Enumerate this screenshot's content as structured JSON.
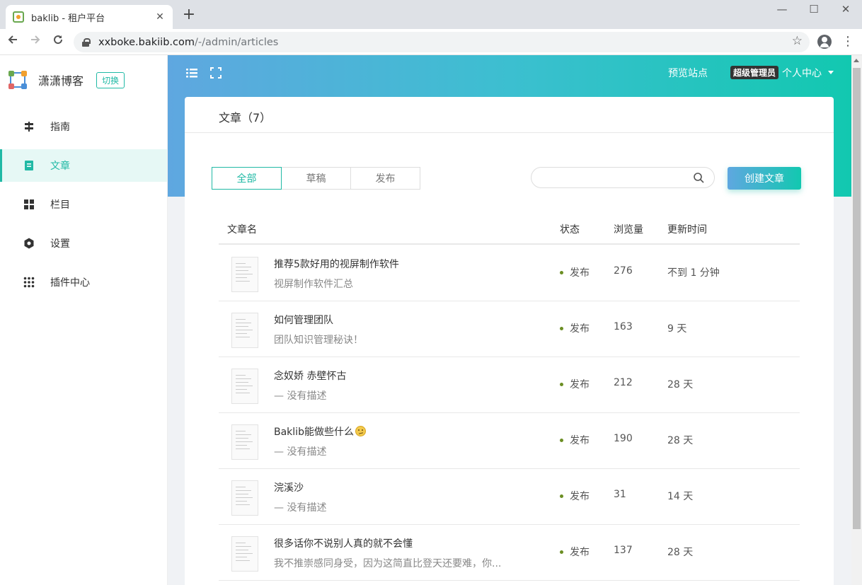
{
  "browser": {
    "tab_title": "baklib - 租户平台",
    "tab_close": "✕",
    "new_tab": "+",
    "url_host": "xxboke.bakiib.com",
    "url_path": "/-/admin/articles",
    "window_minimize": "—",
    "window_maximize": "☐",
    "window_close": "✕"
  },
  "sidebar": {
    "brand_name": "潇潇博客",
    "switch_label": "切换",
    "items": [
      {
        "label": "指南",
        "icon": "signpost-icon"
      },
      {
        "label": "文章",
        "icon": "document-icon",
        "active": true
      },
      {
        "label": "栏目",
        "icon": "grid-icon"
      },
      {
        "label": "设置",
        "icon": "gear-icon"
      },
      {
        "label": "插件中心",
        "icon": "apps-icon"
      }
    ]
  },
  "topbar": {
    "preview": "预览站点",
    "role_badge": "超级管理员",
    "user_center": "个人中心"
  },
  "page": {
    "title": "文章（7）",
    "filters": [
      "全部",
      "草稿",
      "发布"
    ],
    "active_filter": "全部",
    "search_placeholder": "",
    "create_button": "创建文章"
  },
  "table": {
    "headers": {
      "name": "文章名",
      "status": "状态",
      "views": "浏览量",
      "updated": "更新时间"
    },
    "rows": [
      {
        "title": "推荐5款好用的视屏制作软件",
        "desc": "视屏制作软件汇总",
        "status": "发布",
        "views": "276",
        "updated": "不到 1 分钟"
      },
      {
        "title": "如何管理团队",
        "desc": "团队知识管理秘诀！",
        "status": "发布",
        "views": "163",
        "updated": "9 天"
      },
      {
        "title": "念奴娇 赤壁怀古",
        "desc": "— 没有描述",
        "status": "发布",
        "views": "212",
        "updated": "28 天"
      },
      {
        "title": "Baklib能做些什么",
        "desc": "— 没有描述",
        "status": "发布",
        "views": "190",
        "updated": "28 天"
      },
      {
        "title": "浣溪沙",
        "desc": "— 没有描述",
        "status": "发布",
        "views": "31",
        "updated": "14 天"
      },
      {
        "title": "很多话你不说别人真的就不会懂",
        "desc": "我不推崇感同身受，因为这简直比登天还要难，你...",
        "status": "发布",
        "views": "137",
        "updated": "28 天"
      }
    ]
  },
  "colors": {
    "accent": "#20b9a5",
    "gradient_start": "#5fa7e0",
    "gradient_end": "#12c8b0",
    "status_dot": "#6b8e23"
  }
}
